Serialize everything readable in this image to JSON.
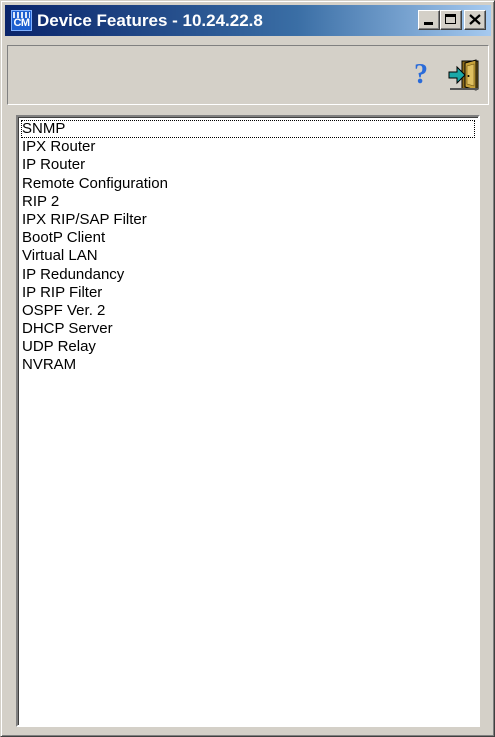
{
  "window": {
    "title": "Device Features - 10.24.22.8",
    "app_icon_text": "CM",
    "controls": [
      "minimize",
      "maximize",
      "close"
    ]
  },
  "toolbar": {
    "help_icon": "help-question-icon",
    "exit_icon": "exit-door-icon"
  },
  "features": {
    "focused_index": 0,
    "items": [
      "SNMP",
      "IPX Router",
      "IP  Router",
      "Remote Configuration",
      "RIP 2",
      "IPX RIP/SAP Filter",
      "BootP Client",
      "Virtual LAN",
      "IP Redundancy",
      "IP RIP Filter",
      "OSPF Ver. 2",
      "DHCP Server",
      "UDP Relay",
      "NVRAM"
    ]
  },
  "colors": {
    "title_start": "#0a246a",
    "title_end": "#a6caf0",
    "face": "#d4d0c8",
    "help_icon": "#2a6bd9",
    "exit_arrow": "#1aa8a8",
    "exit_door": "#c8a23a"
  }
}
